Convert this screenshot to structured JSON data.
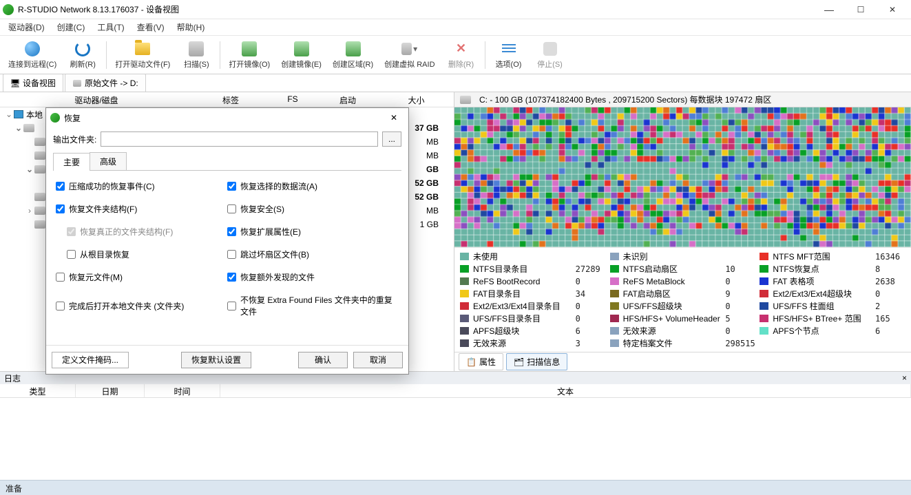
{
  "titlebar": {
    "title": "R-STUDIO Network 8.13.176037 - 设备视图"
  },
  "menu": {
    "driver": "驱动器(D)",
    "create": "创建(C)",
    "tool": "工具(T)",
    "view": "查看(V)",
    "help": "帮助(H)"
  },
  "toolbar": {
    "connect": "连接到远程(C)",
    "refresh": "刷新(R)",
    "openfile": "打开驱动文件(F)",
    "scan": "扫描(S)",
    "openimg": "打开镜像(O)",
    "createimg": "创建镜像(E)",
    "createregion": "创建区域(R)",
    "createraid": "创建虚拟 RAID",
    "delete": "删除(R)",
    "options": "选项(O)",
    "stop": "停止(S)"
  },
  "subtabs": {
    "dev": "设备视图",
    "raw": "原始文件 -> D:"
  },
  "tree": {
    "hdr": {
      "drive": "驱动器/磁盘",
      "label": "标签",
      "fs": "FS",
      "start": "启动",
      "size": "大小"
    },
    "local": "本地",
    "sizes": [
      "37 GB",
      "MB",
      "MB",
      "GB",
      "52 GB",
      "52 GB",
      "MB",
      "1 GB"
    ]
  },
  "diskinfo": "C: - 100 GB (107374182400 Bytes , 209715200 Sectors) 每数据块 197472 扇区",
  "legend": [
    {
      "c": "#69b4a4",
      "n": "未使用",
      "v": ""
    },
    {
      "c": "#8aa2bd",
      "n": "未识别",
      "v": ""
    },
    {
      "c": "#e83028",
      "n": "NTFS MFT范围",
      "v": "16346"
    },
    {
      "c": "#08a026",
      "n": "NTFS目录条目",
      "v": "27289"
    },
    {
      "c": "#08a026",
      "n": "NTFS启动扇区",
      "v": "10"
    },
    {
      "c": "#08a026",
      "n": "NTFS恢复点",
      "v": "8"
    },
    {
      "c": "#537a50",
      "n": "ReFS BootRecord",
      "v": "0"
    },
    {
      "c": "#d66fc7",
      "n": "ReFS MetaBlock",
      "v": "0"
    },
    {
      "c": "#1a34d1",
      "n": "FAT 表格项",
      "v": "2638"
    },
    {
      "c": "#f0c818",
      "n": "FAT目录条目",
      "v": "34"
    },
    {
      "c": "#7a6a20",
      "n": "FAT启动扇区",
      "v": "9"
    },
    {
      "c": "#d02c38",
      "n": "Ext2/Ext3/Ext4超级块",
      "v": "0"
    },
    {
      "c": "#d02c38",
      "n": "Ext2/Ext3/Ext4目录条目",
      "v": "0"
    },
    {
      "c": "#807820",
      "n": "UFS/FFS超级块",
      "v": "0"
    },
    {
      "c": "#2049a0",
      "n": "UFS/FFS 柱面组",
      "v": "2"
    },
    {
      "c": "#5a5a78",
      "n": "UFS/FFS目录条目",
      "v": "0"
    },
    {
      "c": "#a02850",
      "n": "HFS/HFS+ VolumeHeader",
      "v": "5"
    },
    {
      "c": "#c7306f",
      "n": "HFS/HFS+ BTree+ 范围",
      "v": "165"
    },
    {
      "c": "#4a4a5a",
      "n": "APFS超级块",
      "v": "6"
    },
    {
      "c": "#8aa2bd",
      "n": "无效来源",
      "v": "0"
    },
    {
      "c": "#63e0c8",
      "n": "APFS个节点",
      "v": "6"
    },
    {
      "c": "#4a4a5a",
      "n": "无效来源",
      "v": "3"
    },
    {
      "c": "#8aa2bd",
      "n": "特定档案文件",
      "v": "298515"
    },
    {
      "c": "#ffffff",
      "n": "",
      "v": ""
    }
  ],
  "proptabs": {
    "props": "属性",
    "scaninfo": "扫描信息"
  },
  "log": {
    "title": "日志",
    "type": "类型",
    "date": "日期",
    "time": "时间",
    "text": "文本"
  },
  "status": "准备",
  "dialog": {
    "title": "恢复",
    "outlabel": "输出文件夹:",
    "tab_main": "主要",
    "tab_adv": "高级",
    "opts": {
      "o1": "压缩成功的恢复事件(C)",
      "o2": "恢复选择的数据流(A)",
      "o3": "恢复文件夹结构(F)",
      "o4": "恢复安全(S)",
      "o5": "恢复真正的文件夹结构(F)",
      "o6": "恢复扩展属性(E)",
      "o7": "从根目录恢复",
      "o8": "跳过坏扇区文件(B)",
      "o9": "恢复元文件(M)",
      "o10": "恢复额外发现的文件",
      "o11": "完成后打开本地文件夹 (文件夹)",
      "o12": "不恢复 Extra Found Files 文件夹中的重复文件"
    },
    "btn_mask": "定义文件掩码...",
    "btn_default": "恢复默认设置",
    "btn_ok": "确认",
    "btn_cancel": "取消"
  }
}
